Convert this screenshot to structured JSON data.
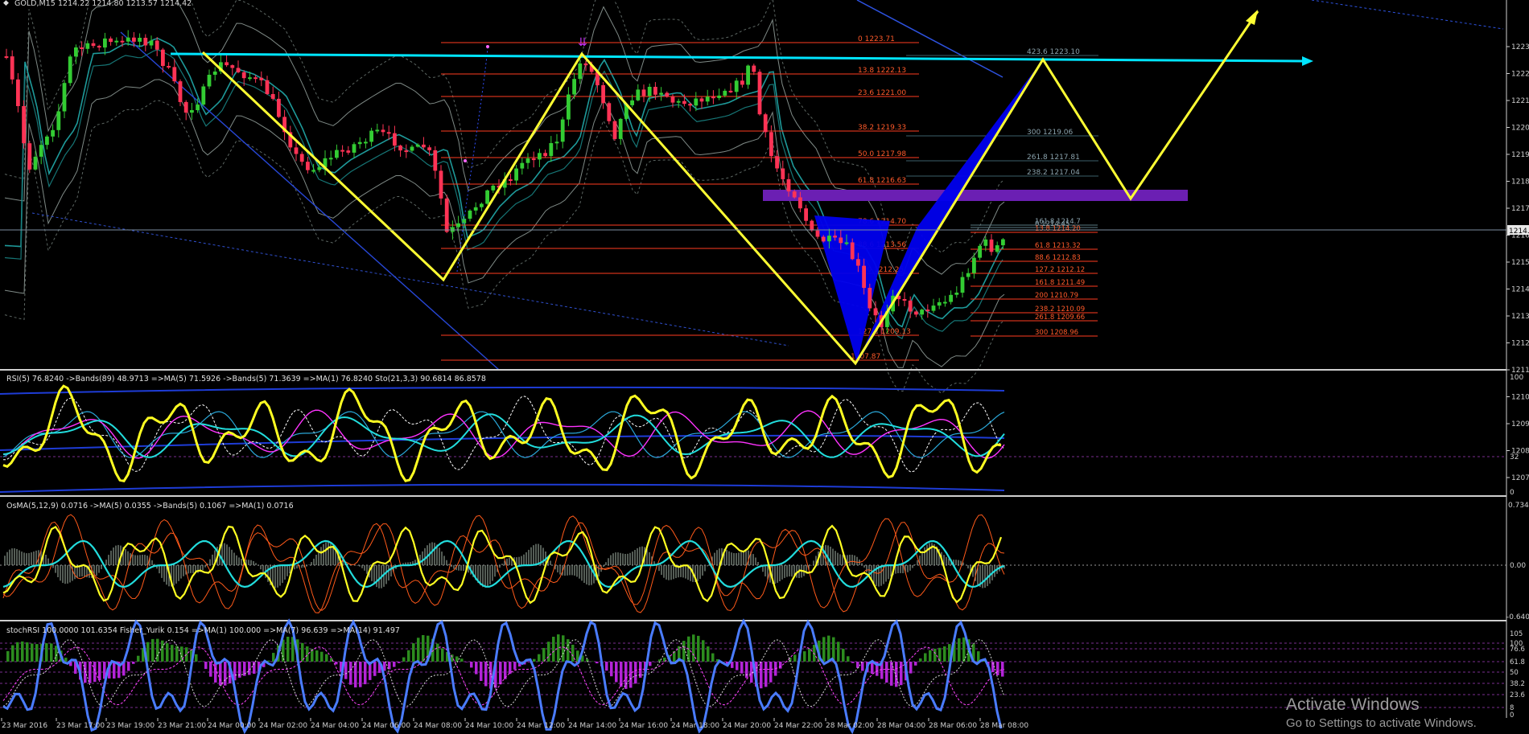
{
  "window": {
    "title": "GOLD,M15",
    "ohlc": "1214.22 1214.80 1213.57 1214.42"
  },
  "price_axis": {
    "labels": [
      "1223.",
      "1222.",
      "1221.",
      "1220.",
      "1219.",
      "1218.",
      "1217.",
      "1216.",
      "1215.",
      "1214.",
      "1213.",
      "1212.",
      "1211.",
      "1210.",
      "1209.",
      "1208.",
      "1207."
    ],
    "current": "1214."
  },
  "time_axis": {
    "labels": [
      "23 Mar 2016",
      "23 Mar 17:00",
      "23 Mar 19:00",
      "23 Mar 21:00",
      "24 Mar 00:00",
      "24 Mar 02:00",
      "24 Mar 04:00",
      "24 Mar 06:00",
      "24 Mar 08:00",
      "24 Mar 10:00",
      "24 Mar 12:00",
      "24 Mar 14:00",
      "24 Mar 16:00",
      "24 Mar 18:00",
      "24 Mar 20:00",
      "24 Mar 22:00",
      "28 Mar 02:00",
      "28 Mar 04:00",
      "28 Mar 06:00",
      "28 Mar 08:00"
    ]
  },
  "fib_main": [
    {
      "label": "0 1223.71"
    },
    {
      "label": "13.8 1222.13"
    },
    {
      "label": "23.6 1221.00"
    },
    {
      "label": "38.2 1219.33"
    },
    {
      "label": "50.0 1217.98"
    },
    {
      "label": "61.8 1216.63"
    },
    {
      "label": "78.6 1214.70"
    },
    {
      "label": "88.6 1213.56"
    },
    {
      "label": "100 1212.25"
    },
    {
      "label": "127.2 1209.13"
    },
    {
      "label": "1207.87"
    }
  ],
  "fib_ext": [
    {
      "label": "423.6 1223.10"
    },
    {
      "label": "300 1219.06"
    },
    {
      "label": "261.8 1217.81"
    },
    {
      "label": "238.2 1217.04"
    },
    {
      "label": "200 1215.79"
    }
  ],
  "fib_right": [
    {
      "label": "161.8 1214.7"
    },
    {
      "label": "0 1214.45"
    },
    {
      "label": "13.8 1214.20"
    },
    {
      "label": "61.8 1213.32"
    },
    {
      "label": "88.6 1212.83"
    },
    {
      "label": "127.2 1212.12"
    },
    {
      "label": "161.8 1211.49"
    },
    {
      "label": "200 1210.79"
    },
    {
      "label": "238.2 1210.09"
    },
    {
      "label": "261.8 1209.66"
    },
    {
      "label": "300 1208.96"
    }
  ],
  "panels": {
    "rsi": {
      "caption": "RSI(5) 76.8240  ->Bands(89) 48.9713  =>MA(5) 71.5926  ->Bands(5) 71.3639  =>MA(1) 76.8240  Sto(21,3,3) 90.6814 86.8578",
      "scale": [
        "100",
        "32",
        "0"
      ]
    },
    "osma": {
      "caption": "OsMA(5,12,9) 0.0716  ->MA(5) 0.0355  ->Bands(5) 0.1067  =>MA(1) 0.0716",
      "scale": [
        "0.734",
        "0.00",
        "-0.640"
      ]
    },
    "stoch": {
      "caption": "stochRSI 100.0000 101.6354  Fisher_Yurik 0.154  =>MA(1) 100.000  =>MA(7) 96.639  =>MA(14) 91.497",
      "scale": [
        "105",
        "100",
        "76.6",
        "61.8",
        "50",
        "38.2",
        "23.6",
        "8",
        "0"
      ]
    }
  },
  "colors": {
    "background": "#000000",
    "bull_candle": "#33cc33",
    "bear_candle": "#ff3355",
    "fib_line": "#ff3b1f",
    "horizontal_cyan": "#00e5ff",
    "zigzag": "#ffff33",
    "harmonic_fill": "#0000ff",
    "zone_purple": "#6b1fb3",
    "rsi_line": "#ffff22",
    "separator": "#d0d0d0"
  },
  "watermark": {
    "title": "Activate Windows",
    "subtitle": "Go to Settings to activate Windows."
  }
}
